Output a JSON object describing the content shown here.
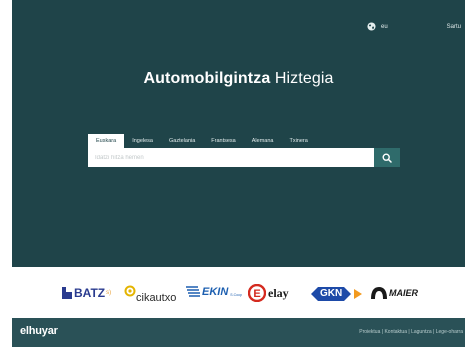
{
  "header": {
    "language_code": "eu",
    "login_label": "Sartu"
  },
  "main": {
    "title_bold": "Automobilgintza",
    "title_light": "Hiztegia"
  },
  "search": {
    "tabs": [
      "Euskara",
      "Ingelesa",
      "Gaztelania",
      "Frantsesa",
      "Alemana",
      "Txinera"
    ],
    "active_tab": "Euskara",
    "placeholder": "Idatzi hitza hemen"
  },
  "sponsors": [
    {
      "name": "BATZ",
      "suffix": "s)",
      "color": "#2a3b8f"
    },
    {
      "name": "cikautxo",
      "color": "#2b2b2b"
    },
    {
      "name": "EKIN",
      "suffix": "S.Coop",
      "color": "#1d5fb0"
    },
    {
      "name": "elay",
      "color": "#1a1a1a"
    },
    {
      "name": "GKN",
      "color": "#1d4aa8"
    },
    {
      "name": "MAIER",
      "color": "#1a1a1a"
    }
  ],
  "footer": {
    "logo": "elhuyar",
    "links": [
      "Proiektua",
      "Kontaktua",
      "Laguntza",
      "Lege-oharra"
    ]
  },
  "colors": {
    "hero_background": "#1f4449",
    "search_button": "#2f6b6b",
    "footer_background": "#2a5157"
  }
}
